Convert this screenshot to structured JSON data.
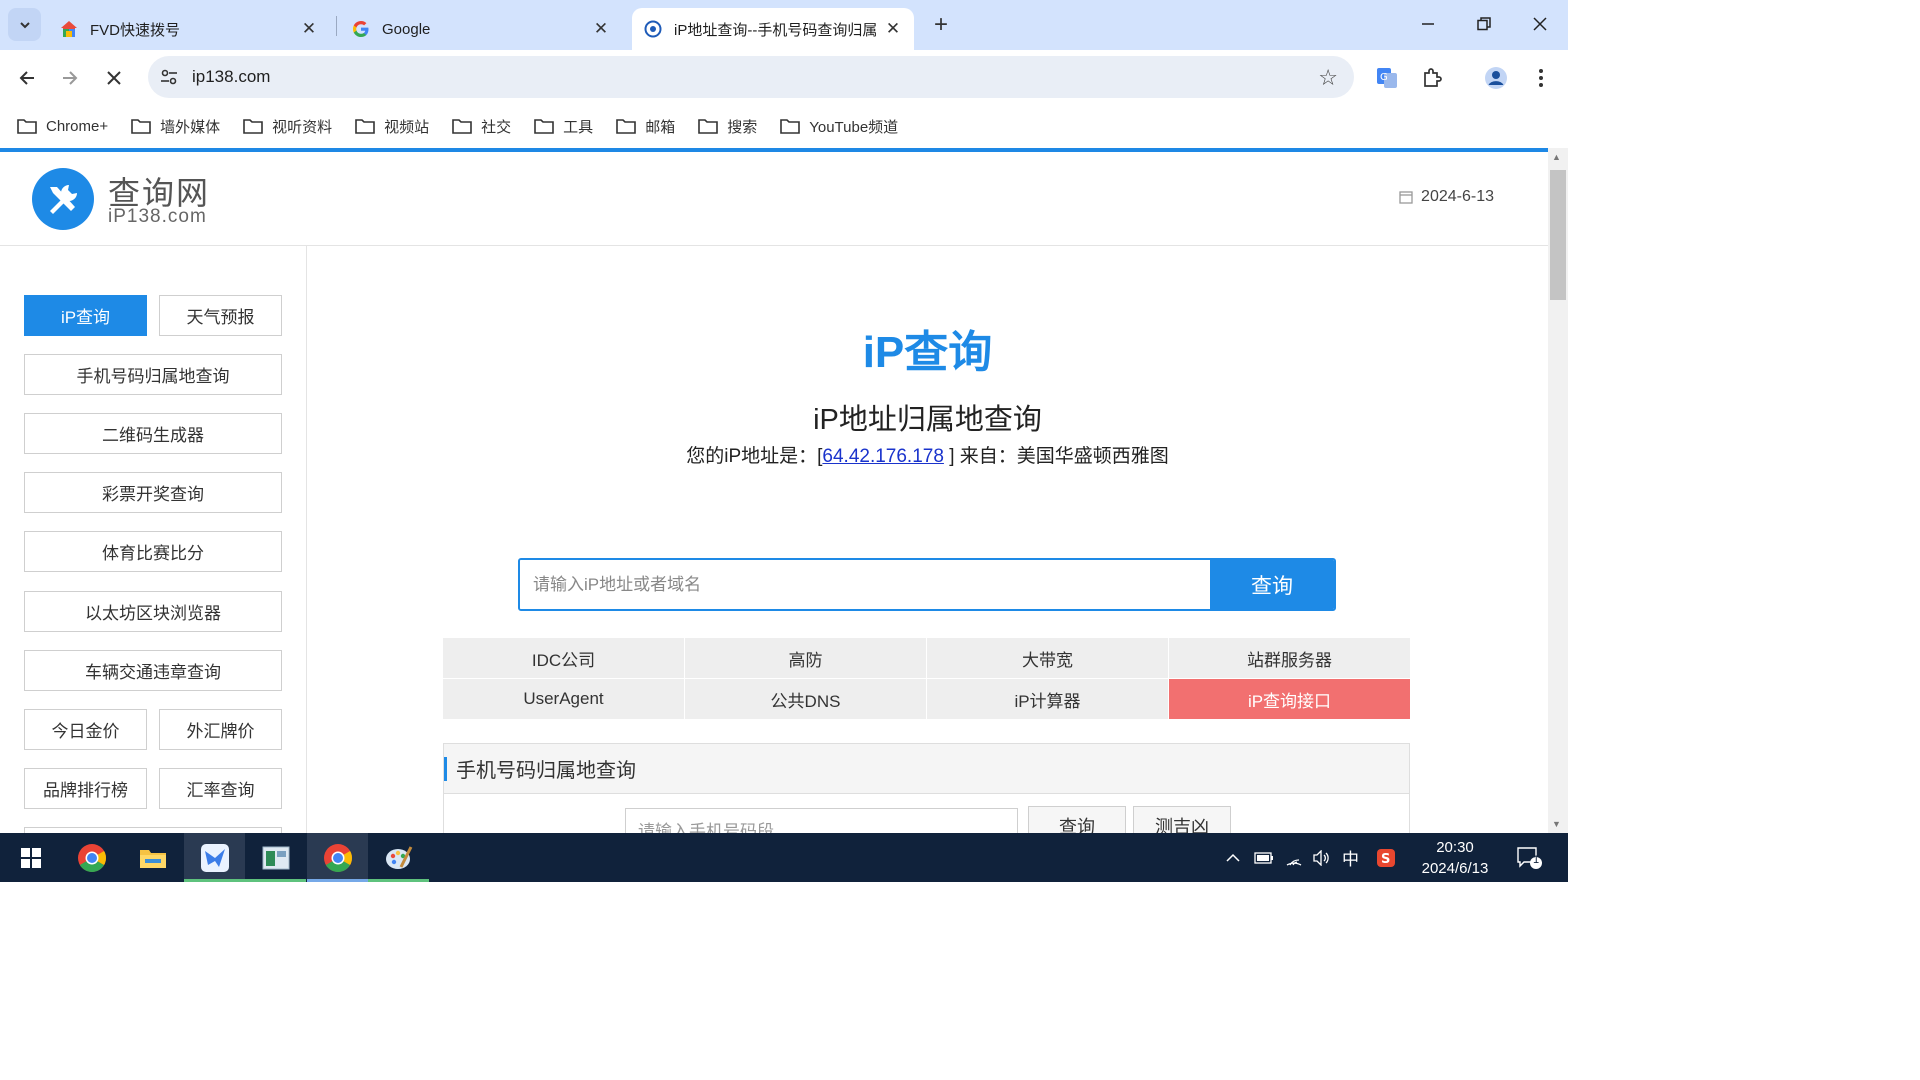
{
  "browser": {
    "tabs": [
      {
        "title": "FVD快速拨号",
        "icon": "fvd-icon"
      },
      {
        "title": "Google",
        "icon": "google-icon"
      },
      {
        "title": "iP地址查询--手机号码查询归属",
        "icon": "ip138-icon"
      }
    ],
    "new_tab": "+",
    "url": "ip138.com",
    "bookmarks": [
      "Chrome+",
      "墙外媒体",
      "视听资料",
      "视频站",
      "社交",
      "工具",
      "邮箱",
      "搜索",
      "YouTube频道"
    ]
  },
  "site": {
    "logo_title": "查询网",
    "logo_sub": "iP138.com",
    "date": "2024-6-13"
  },
  "sidebar": {
    "items": [
      {
        "label": "iP查询",
        "active": true
      },
      {
        "label": "天气预报"
      },
      {
        "label": "手机号码归属地查询"
      },
      {
        "label": "二维码生成器"
      },
      {
        "label": "彩票开奖查询"
      },
      {
        "label": "体育比赛比分"
      },
      {
        "label": "以太坊区块浏览器"
      },
      {
        "label": "车辆交通违章查询"
      },
      {
        "label": "今日金价"
      },
      {
        "label": "外汇牌价"
      },
      {
        "label": "品牌排行榜"
      },
      {
        "label": "汇率查询"
      }
    ]
  },
  "main": {
    "heading": "iP查询",
    "subheading": "iP地址归属地查询",
    "ip_prefix": "您的iP地址是：[",
    "ip_address": "64.42.176.178",
    "ip_suffix": " ] 来自：美国华盛顿西雅图",
    "search_placeholder": "请输入iP地址或者域名",
    "search_button": "查询",
    "quick_links": [
      "IDC公司",
      "高防",
      "大带宽",
      "站群服务器",
      "UserAgent",
      "公共DNS",
      "iP计算器",
      "iP查询接口"
    ],
    "phone_panel": {
      "title": "手机号码归属地查询",
      "placeholder": "请输入手机号码段",
      "query_button": "查询",
      "speed_button": "测吉凶"
    }
  },
  "taskbar": {
    "ime": "中",
    "time": "20:30",
    "date": "2024/6/13",
    "notifications": "1"
  },
  "colors": {
    "accent": "#1e8ae6",
    "tab_strip": "#d3e3fd",
    "taskbar": "#10223b",
    "highlight_red": "#f27070"
  }
}
